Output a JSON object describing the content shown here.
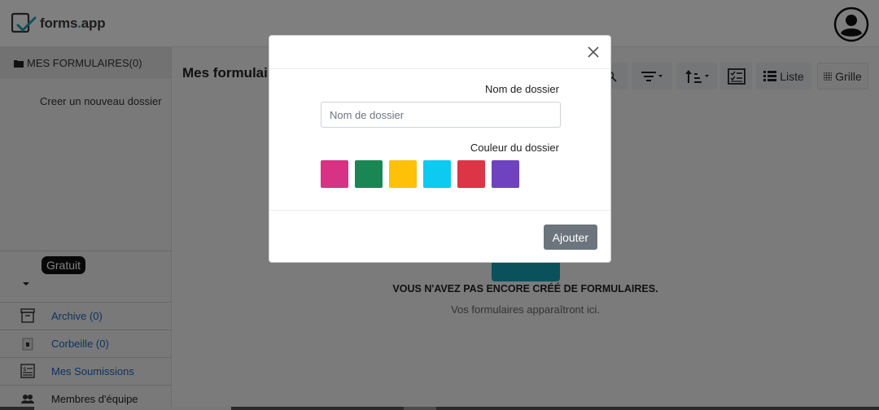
{
  "app": {
    "logo_name": "forms",
    "logo_dot": ".",
    "logo_tld": "app"
  },
  "sidebar": {
    "header": "MES FORMULAIRES(0)",
    "create_folder": "Creer un nouveau dossier",
    "plan_badge": "Gratuit",
    "items": [
      {
        "label": "Archive (0)",
        "icon": "archive-icon"
      },
      {
        "label": "Corbeille (0)",
        "icon": "trash-icon"
      },
      {
        "label": "Mes Soumissions",
        "icon": "submissions-icon"
      },
      {
        "label": "Membres d'équipe",
        "icon": "team-icon"
      }
    ]
  },
  "main": {
    "title": "Mes formulaires",
    "toolbar": {
      "list_label": "Liste",
      "grid_label": "Grille"
    },
    "empty_title": "VOUS N'AVEZ PAS ENCORE CRÉÉ DE FORMULAIRES.",
    "empty_subtitle": "Vos formulaires apparaîtront ici."
  },
  "modal": {
    "name_label": "Nom de dossier",
    "name_placeholder": "Nom de dossier",
    "name_value": "",
    "color_label": "Couleur du dossier",
    "colors": [
      "#d63384",
      "#198754",
      "#ffc107",
      "#0dcaf0",
      "#dc3545",
      "#6f42c1"
    ],
    "submit_label": "Ajouter"
  }
}
